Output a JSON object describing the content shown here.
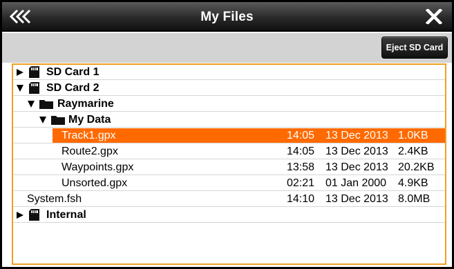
{
  "header": {
    "title": "My Files",
    "back_icon": "double-chevron-left-icon",
    "close_icon": "close-x-icon"
  },
  "toolbar": {
    "eject_label": "Eject SD Card"
  },
  "tree": {
    "sd_card_1": {
      "label": "SD Card 1",
      "expanded": false
    },
    "sd_card_2": {
      "label": "SD Card 2",
      "expanded": true
    },
    "raymarine": {
      "label": "Raymarine",
      "expanded": true
    },
    "my_data": {
      "label": "My Data",
      "expanded": true
    },
    "files": [
      {
        "name": "Track1.gpx",
        "time": "14:05",
        "date": "13 Dec 2013",
        "size": "1.0KB",
        "selected": true
      },
      {
        "name": "Route2.gpx",
        "time": "14:05",
        "date": "13 Dec 2013",
        "size": "2.4KB",
        "selected": false
      },
      {
        "name": "Waypoints.gpx",
        "time": "13:58",
        "date": "13 Dec 2013",
        "size": "20.2KB",
        "selected": false
      },
      {
        "name": "Unsorted.gpx",
        "time": "02:21",
        "date": "01 Jan 2000",
        "size": "4.9KB",
        "selected": false
      }
    ],
    "system_file": {
      "name": "System.fsh",
      "time": "14:10",
      "date": "13 Dec 2013",
      "size": "8.0MB"
    },
    "internal": {
      "label": "Internal",
      "expanded": false
    }
  },
  "colors": {
    "selection": "#ff6a00",
    "panel_border": "#f0a020",
    "toolbar_bg": "#d3d3d3"
  }
}
